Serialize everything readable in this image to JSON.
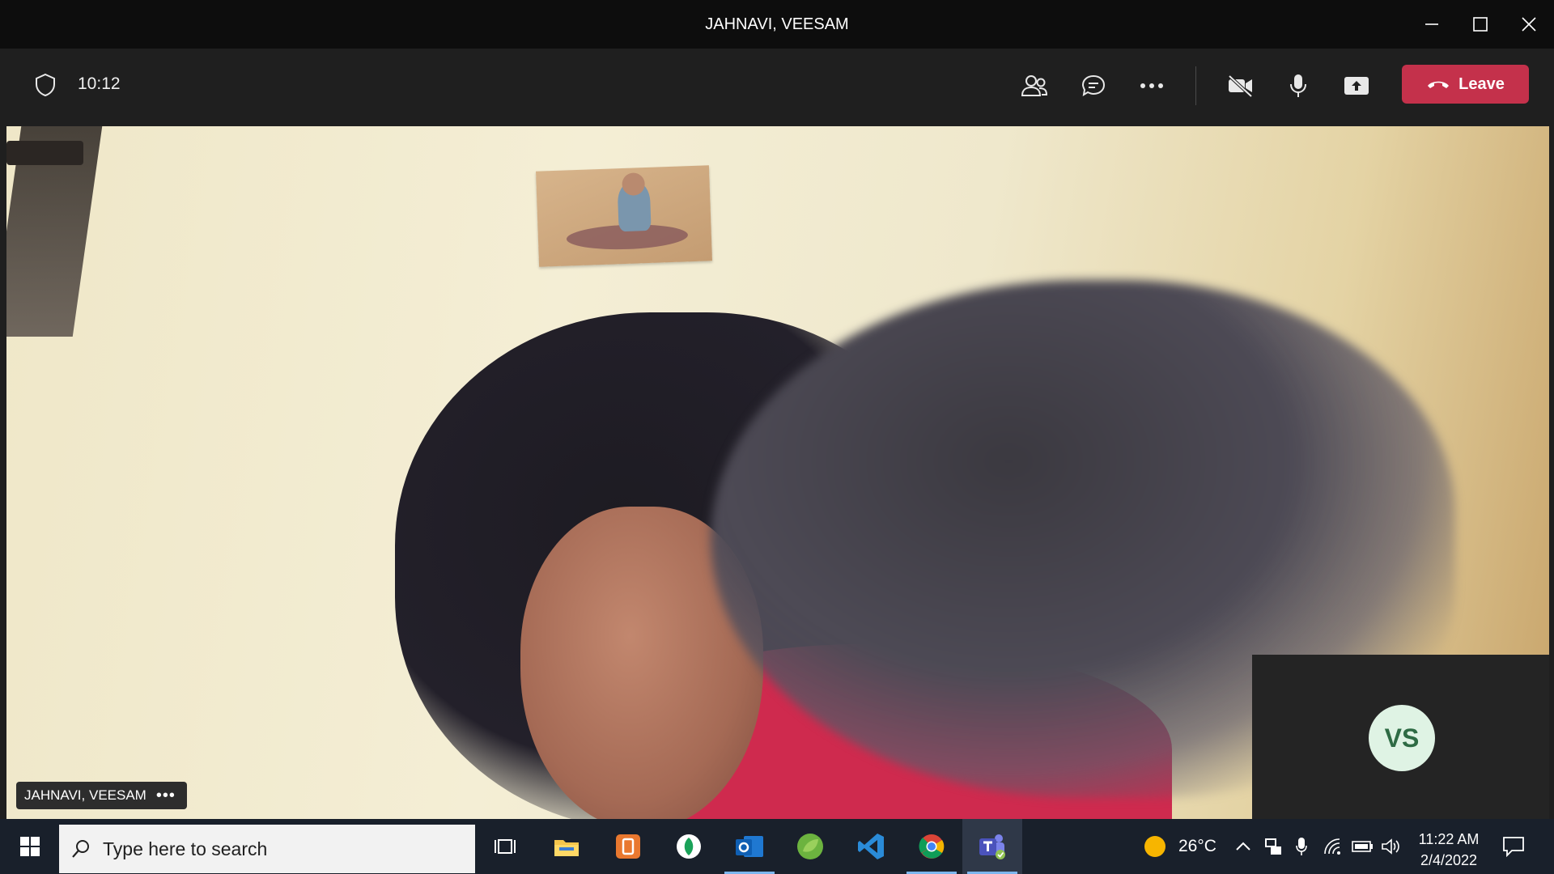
{
  "window": {
    "title": "JAHNAVI, VEESAM"
  },
  "toolbar": {
    "timer": "10:12",
    "leave_label": "Leave",
    "colors": {
      "leave": "#c4314b",
      "background": "#1f1f1f"
    }
  },
  "stage": {
    "main_participant_name": "JAHNAVI, VEESAM",
    "self_view_initials": "VS"
  },
  "taskbar": {
    "search_placeholder": "Type here to search",
    "weather": "26°C",
    "time": "11:22 AM",
    "date": "2/4/2022",
    "apps": [
      "task-view",
      "file-explorer",
      "ms-office",
      "app-green",
      "outlook",
      "spring-tool",
      "vscode",
      "chrome",
      "teams"
    ]
  }
}
